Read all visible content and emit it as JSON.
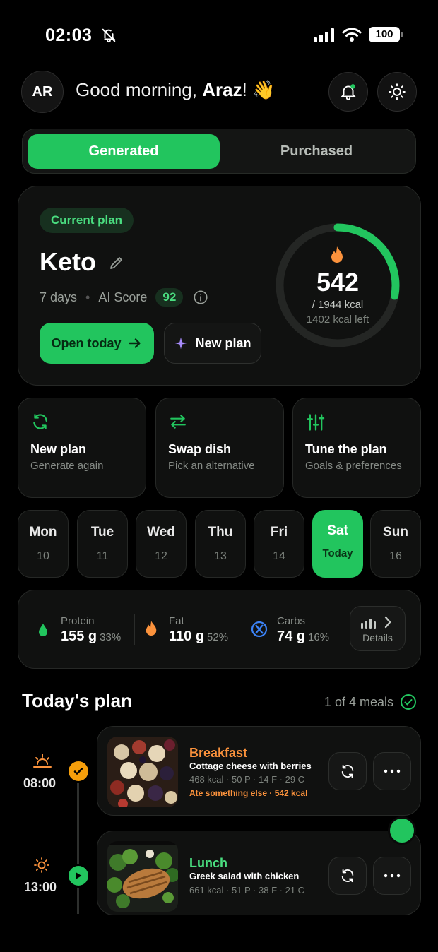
{
  "status_bar": {
    "time": "02:03",
    "battery": "100",
    "icons": [
      "bell-off-icon",
      "signal-icon",
      "wifi-icon",
      "battery-icon"
    ]
  },
  "header": {
    "avatar_initials": "AR",
    "greeting_prefix": "Good morning, ",
    "user_name": "Araz",
    "greeting_suffix": "!",
    "wave_emoji": "👋",
    "notification_icon": "bell-icon",
    "theme_icon": "sun-icon"
  },
  "tabs": [
    {
      "label": "Generated",
      "active": true
    },
    {
      "label": "Purchased",
      "active": false
    }
  ],
  "plan": {
    "chip": "Current plan",
    "name": "Keto",
    "duration": "7 days",
    "score_label": "AI Score",
    "score": "92",
    "open_button": "Open today",
    "new_button": "New plan",
    "calories_eaten": "542",
    "calories_total": "/ 1944 kcal",
    "calories_left": "1402 kcal left",
    "calorie_progress": 0.279
  },
  "actions": [
    {
      "title": "New plan",
      "subtitle": "Generate again",
      "icon": "refresh-icon"
    },
    {
      "title": "Swap dish",
      "subtitle": "Pick an alternative",
      "icon": "swap-icon"
    },
    {
      "title": "Tune the plan",
      "subtitle": "Goals & preferences",
      "icon": "sliders-icon"
    }
  ],
  "days": [
    {
      "name": "Mon",
      "num": "10"
    },
    {
      "name": "Tue",
      "num": "11"
    },
    {
      "name": "Wed",
      "num": "12"
    },
    {
      "name": "Thu",
      "num": "13"
    },
    {
      "name": "Fri",
      "num": "14"
    },
    {
      "name": "Sat",
      "num": "Today",
      "active": true
    },
    {
      "name": "Sun",
      "num": "16"
    }
  ],
  "macros": {
    "protein": {
      "label": "Protein",
      "value": "155 g",
      "pct": "33%"
    },
    "fat": {
      "label": "Fat",
      "value": "110 g",
      "pct": "52%"
    },
    "carbs": {
      "label": "Carbs",
      "value": "74 g",
      "pct": "16%"
    },
    "details": "Details"
  },
  "today": {
    "title": "Today's plan",
    "count": "1 of 4 meals"
  },
  "meals": [
    {
      "time": "08:00",
      "name": "Breakfast",
      "dish": "Cottage cheese with berries",
      "stats": "468 kcal · 50 P · 14 F · 29 C",
      "note": "Ate something else · 542 kcal",
      "status": "done"
    },
    {
      "time": "13:00",
      "name": "Lunch",
      "dish": "Greek salad with chicken",
      "stats": "661 kcal · 51 P · 38 F · 21 C",
      "status": "current"
    }
  ],
  "colors": {
    "accent": "#22c55e",
    "accent_light": "#4ade80",
    "orange": "#fb923c",
    "card": "#101110",
    "background": "#000000"
  }
}
